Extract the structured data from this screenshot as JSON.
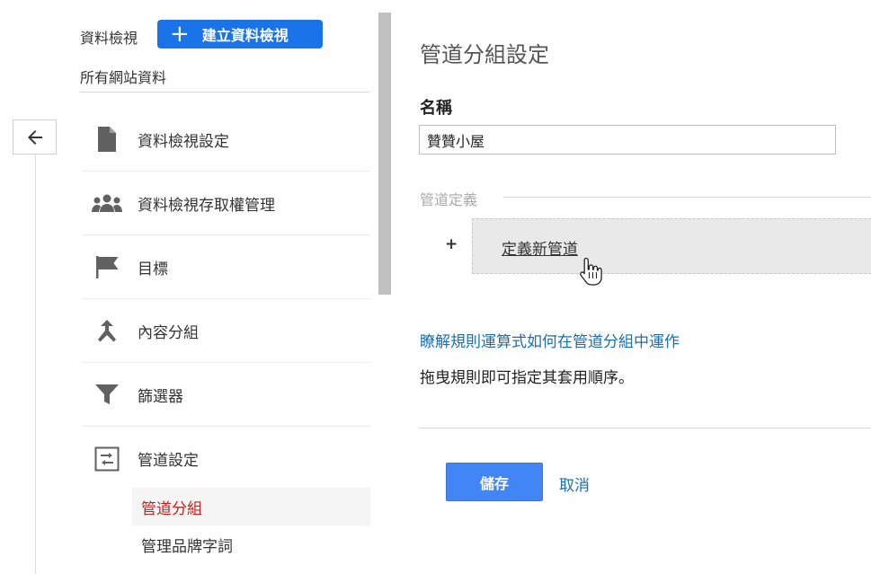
{
  "header": {
    "view_label": "資料檢視",
    "create_button": {
      "icon": "plus",
      "label": "建立資料檢視"
    },
    "site_label": "所有網站資料"
  },
  "back_button": {
    "icon": "arrow-left-icon"
  },
  "nav": {
    "items": [
      {
        "label": "資料檢視設定",
        "icon": "document-icon"
      },
      {
        "label": "資料檢視存取權管理",
        "icon": "users-icon"
      },
      {
        "label": "目標",
        "icon": "flag-icon"
      },
      {
        "label": "內容分組",
        "icon": "merge-icon"
      },
      {
        "label": "篩選器",
        "icon": "filter-icon"
      },
      {
        "label": "管道設定",
        "icon": "channel-settings-icon"
      }
    ],
    "sub_items": [
      {
        "label": "管道分組",
        "active": true
      },
      {
        "label": "管理品牌字詞",
        "active": false
      }
    ]
  },
  "main": {
    "title": "管道分組設定",
    "name_label": "名稱",
    "name_value": "贊贊小屋",
    "definition_label": "管道定義",
    "add_symbol": "+",
    "new_channel_link": "定義新管道",
    "learn_link": "瞭解規則運算式如何在管道分組中運作",
    "drag_hint": "拖曳規則即可指定其套用順序。",
    "save_label": "儲存",
    "cancel_label": "取消"
  },
  "colors": {
    "primary_blue": "#1a73e8",
    "save_blue": "#4285f4",
    "link_blue": "#1a6fb0",
    "active_red": "#c5221f",
    "icon_gray": "#616161"
  }
}
